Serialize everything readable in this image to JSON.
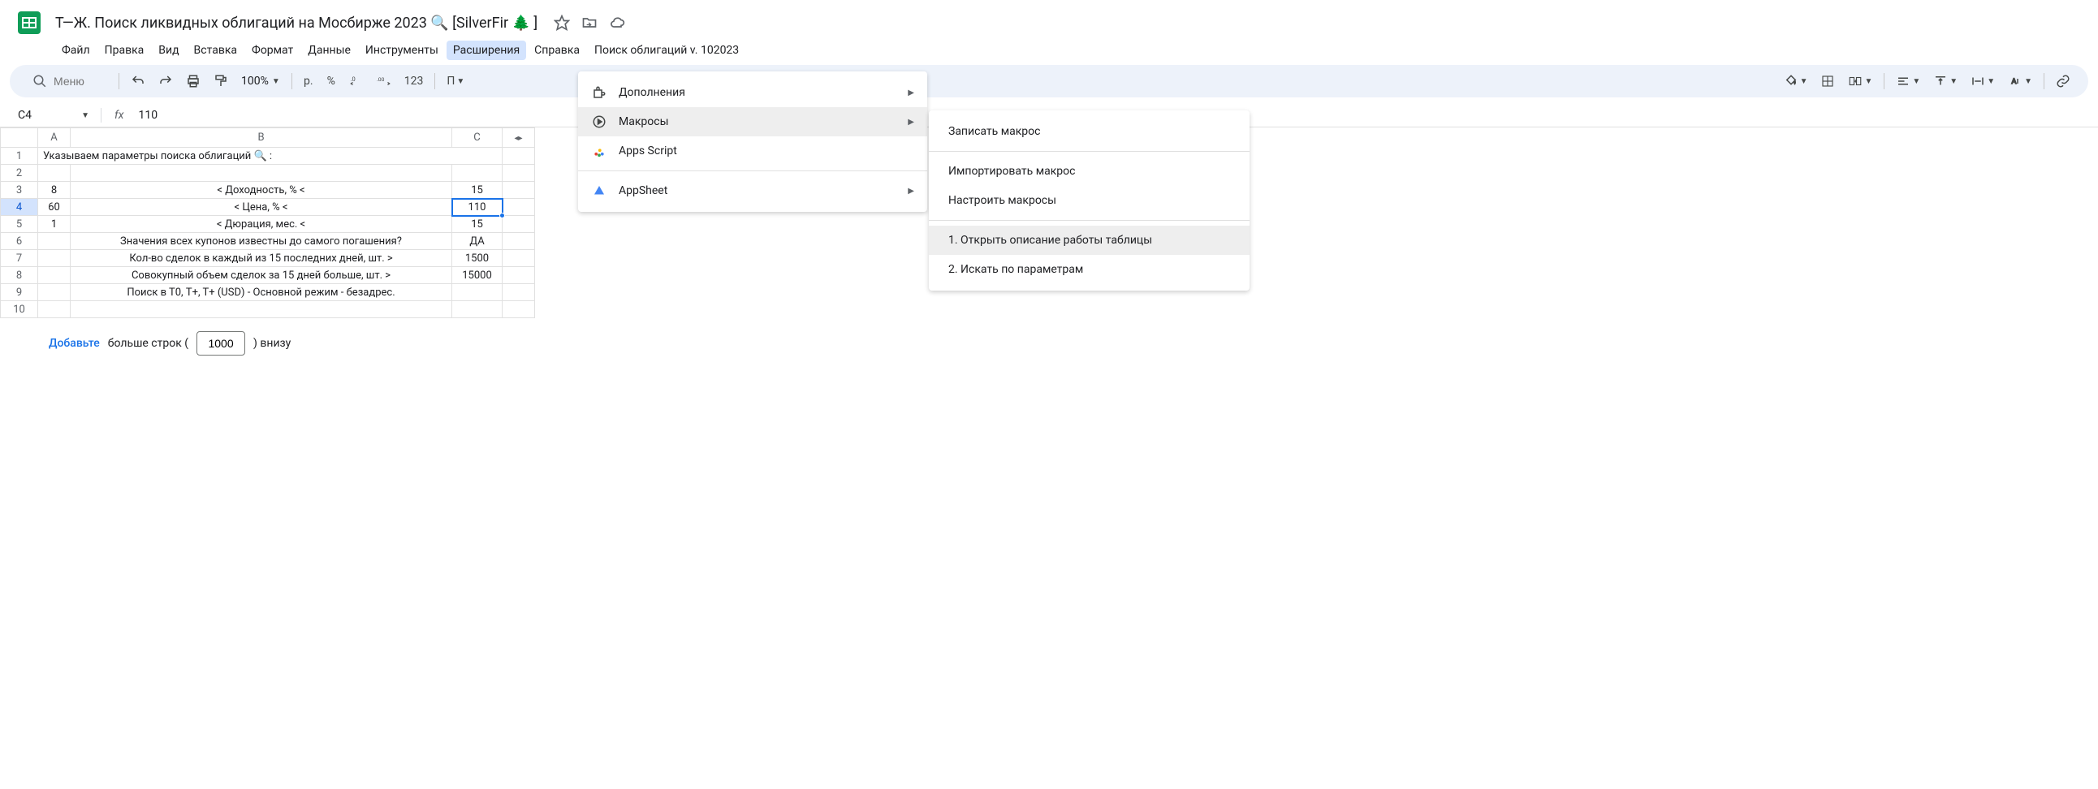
{
  "header": {
    "title": "Т—Ж. Поиск ликвидных облигаций на Мосбирже 2023 🔍 [SilverFir 🌲 ]"
  },
  "menubar": {
    "file": "Файл",
    "edit": "Правка",
    "view": "Вид",
    "insert": "Вставка",
    "format": "Формат",
    "data": "Данные",
    "tools": "Инструменты",
    "extensions": "Расширения",
    "help": "Справка",
    "custom": "Поиск облигаций v. 102023"
  },
  "toolbar": {
    "search_placeholder": "Меню",
    "zoom": "100%",
    "currency": "р.",
    "percent": "%",
    "dec_dec": ".0",
    "dec_inc": ".00",
    "numfmt": "123"
  },
  "formula": {
    "cell_ref": "C4",
    "value": "110"
  },
  "columns": {
    "a": "A",
    "b": "B",
    "c": "C"
  },
  "rows": {
    "r1": {
      "n": "1",
      "b": "Указываем параметры поиска облигаций 🔍 :"
    },
    "r2": {
      "n": "2"
    },
    "r3": {
      "n": "3",
      "a": "8",
      "b": "< Доходность, % <",
      "c": "15"
    },
    "r4": {
      "n": "4",
      "a": "60",
      "b": "< Цена, % <",
      "c": "110"
    },
    "r5": {
      "n": "5",
      "a": "1",
      "b": "< Дюрация, мес. <",
      "c": "15"
    },
    "r6": {
      "n": "6",
      "b": "Значения всех купонов известны до самого погашения?",
      "c": "ДА"
    },
    "r7": {
      "n": "7",
      "b": "Кол-во сделок в каждый из 15 последних дней, шт. >",
      "c": "1500"
    },
    "r8": {
      "n": "8",
      "b": "Совокупный объем сделок за 15 дней больше, шт.  >",
      "c": "15000"
    },
    "r9": {
      "n": "9",
      "b": "Поиск в Т0, T+, T+ (USD) - Основной режим - безадрес."
    },
    "r10": {
      "n": "10"
    }
  },
  "add_rows": {
    "button": "Добавьте",
    "before": "больше строк (",
    "count": "1000",
    "after": ") внизу"
  },
  "extensions_menu": {
    "addons": "Дополнения",
    "macros": "Макросы",
    "apps_script": "Apps Script",
    "appsheet": "AppSheet"
  },
  "macros_menu": {
    "record": "Записать макрос",
    "import": "Импортировать макрос",
    "configure": "Настроить макросы",
    "m1": "1. Открыть описание работы таблицы",
    "m2": "2. Искать по параметрам"
  }
}
